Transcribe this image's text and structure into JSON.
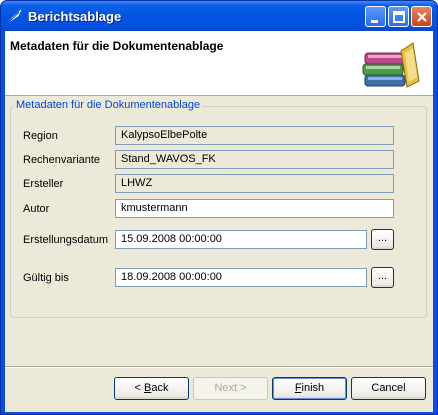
{
  "window": {
    "title": "Berichtsablage"
  },
  "header": {
    "title": "Metadaten für die Dokumentenablage",
    "graphic_icon": "books-icon"
  },
  "group": {
    "legend": "Metadaten für die Dokumentenablage",
    "fields": {
      "region": {
        "label": "Region",
        "value": "KalypsoElbePolte"
      },
      "rechenvariante": {
        "label": "Rechenvariante",
        "value": "Stand_WAVOS_FK"
      },
      "ersteller": {
        "label": "Ersteller",
        "value": "LHWZ"
      },
      "autor": {
        "label": "Autor",
        "value": "kmustermann"
      },
      "erstellungsdatum": {
        "label": "Erstellungsdatum",
        "value": "15.09.2008 00:00:00",
        "button": "..."
      },
      "gueltig_bis": {
        "label": "Gültig bis",
        "value": "18.09.2008 00:00:00",
        "button": "..."
      }
    }
  },
  "buttons": {
    "back": {
      "prefix": "< ",
      "mnemonic": "B",
      "rest": "ack"
    },
    "next": {
      "label": "Next >"
    },
    "finish": {
      "mnemonic": "F",
      "rest": "inish"
    },
    "cancel": {
      "label": "Cancel"
    }
  },
  "colors": {
    "titlebar": "#0454e3",
    "legend": "#0046d5",
    "dialog_bg": "#ece9d8"
  }
}
